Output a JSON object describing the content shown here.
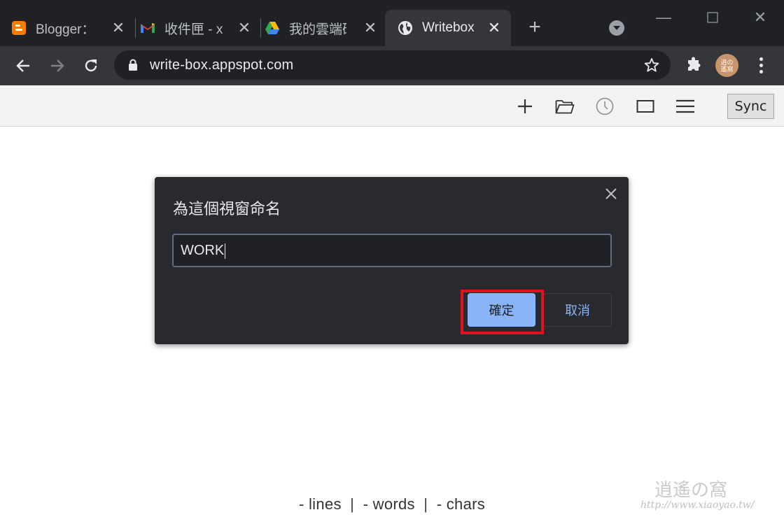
{
  "browser": {
    "tabs": [
      {
        "title": "Blogger：",
        "favicon": "blogger-icon",
        "active": false
      },
      {
        "title": "收件匣 - x",
        "favicon": "gmail-icon",
        "active": false
      },
      {
        "title": "我的雲端硬",
        "favicon": "google-drive-icon",
        "active": false
      },
      {
        "title": "Writebox",
        "favicon": "globe-icon",
        "active": true
      }
    ],
    "url": "write-box.appspot.com",
    "avatar_text": "逍の遙窩"
  },
  "writebox": {
    "toolbar_icons": [
      "plus-icon",
      "folder-icon",
      "clock-icon",
      "window-icon",
      "menu-icon"
    ],
    "sync_label": "Sync",
    "status": {
      "lines": "- lines",
      "words": "- words",
      "chars": "- chars",
      "separator": "|"
    }
  },
  "dialog": {
    "title": "為這個視窗命名",
    "input_value": "WORK",
    "confirm_label": "確定",
    "cancel_label": "取消"
  },
  "watermark": {
    "site_name": "逍遙の窩",
    "site_url": "http://www.xiaoyao.tw/"
  },
  "colors": {
    "highlight": "#e0121f",
    "dialog_bg": "#292a2d",
    "confirm_bg": "#8ab4f8"
  }
}
